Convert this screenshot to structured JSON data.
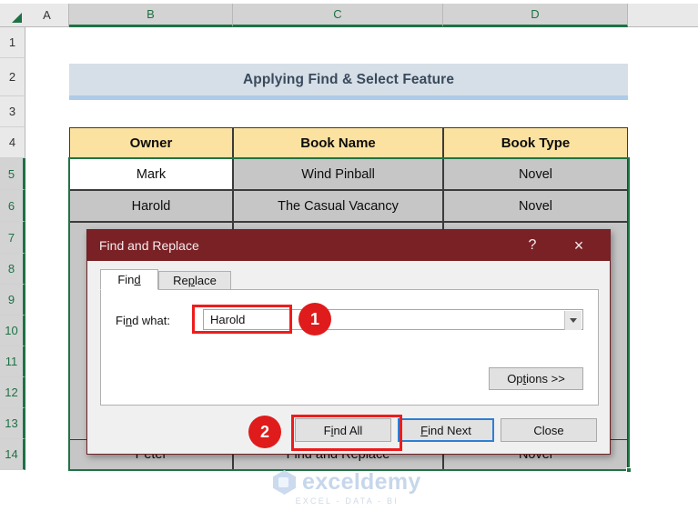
{
  "spreadsheet": {
    "column_headers": [
      "A",
      "B",
      "C",
      "D"
    ],
    "selected_columns": [
      "B",
      "C",
      "D"
    ],
    "row_headers": [
      "1",
      "2",
      "3",
      "4",
      "5",
      "6",
      "7",
      "8",
      "9",
      "10",
      "11",
      "12",
      "13",
      "14"
    ],
    "selected_rows": [
      "5",
      "6",
      "7",
      "8",
      "9",
      "10",
      "11",
      "12",
      "13",
      "14"
    ],
    "title_cell": {
      "text": "Applying Find & Select Feature",
      "fill": "#d6dfe8",
      "font_color": "#3a4a5c"
    },
    "table": {
      "headers": [
        "Owner",
        "Book Name",
        "Book Type"
      ],
      "header_fill": "#fbe2a0",
      "rows": [
        {
          "cells": [
            "Mark",
            "Wind Pinball",
            "Novel"
          ],
          "active_cell_index": 0
        },
        {
          "cells": [
            "Harold",
            "The Casual Vacancy",
            "Novel"
          ],
          "active_cell_index": -1
        }
      ],
      "partial_bottom_row": {
        "cells": [
          "Peter",
          "Find and Replace",
          "Novel"
        ]
      },
      "selection_fill": "#c6c6c6",
      "active_fill": "#ffffff",
      "selection_border": "#217346"
    }
  },
  "dialog": {
    "title": "Find and Replace",
    "title_bar_color": "#7a2126",
    "help_icon": "?",
    "close_icon": "×",
    "tabs": [
      {
        "label_before": "Fin",
        "accel": "d",
        "label_after": "",
        "active": true
      },
      {
        "label_before": "Re",
        "accel": "p",
        "label_after": "lace",
        "active": false
      }
    ],
    "find_what": {
      "label_before": "Fi",
      "label_accel": "n",
      "label_after": "d what:",
      "value": "Harold",
      "placeholder": "",
      "dropdown_icon": "chevron-down-icon"
    },
    "options_button": {
      "label_before": "Op",
      "accel": "t",
      "label_after": "ions >>"
    },
    "footer_buttons": [
      {
        "label_before": "F",
        "accel": "i",
        "label_after": "nd All",
        "highlighted": true,
        "focused": false
      },
      {
        "label_before": "",
        "accel": "F",
        "label_after": "ind Next",
        "highlighted": false,
        "focused": true
      },
      {
        "label_before": "Close",
        "accel": "",
        "label_after": "",
        "highlighted": false,
        "focused": false
      }
    ]
  },
  "annotations": {
    "badges": [
      {
        "number": "1"
      },
      {
        "number": "2"
      }
    ],
    "highlight_color": "#ee1c1c",
    "badge_color": "#e01b1b",
    "focus_color": "#2f7fd4"
  },
  "watermark": {
    "name": "exceldemy",
    "tagline": "EXCEL - DATA - BI"
  }
}
